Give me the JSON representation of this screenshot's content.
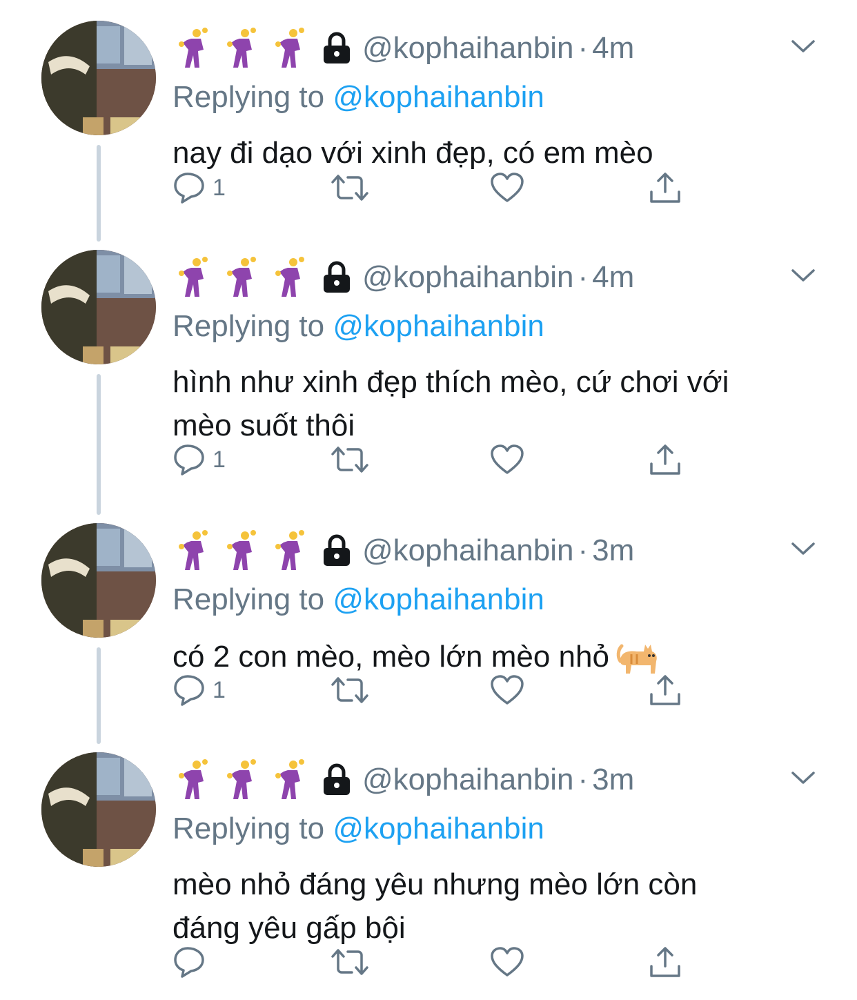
{
  "tweets": [
    {
      "handle": "@kophaihanbin",
      "time": "4m",
      "reply_prefix": "Replying to",
      "reply_to": "@kophaihanbin",
      "text": "nay đi dạo với xinh đẹp, có em mèo",
      "reply_count": "1"
    },
    {
      "handle": "@kophaihanbin",
      "time": "4m",
      "reply_prefix": "Replying to",
      "reply_to": "@kophaihanbin",
      "text": "hình như xinh đẹp thích mèo, cứ chơi với mèo suốt thôi",
      "reply_count": "1"
    },
    {
      "handle": "@kophaihanbin",
      "time": "3m",
      "reply_prefix": "Replying to",
      "reply_to": "@kophaihanbin",
      "text": "có 2 con mèo, mèo lớn mèo nhỏ",
      "text_emoji": "cat-emoji",
      "reply_count": "1"
    },
    {
      "handle": "@kophaihanbin",
      "time": "3m",
      "reply_prefix": "Replying to",
      "reply_to": "@kophaihanbin",
      "text": "mèo nhỏ đáng yêu nhưng mèo lớn còn đáng yêu gấp bội",
      "reply_count": ""
    }
  ],
  "display_name_icons": [
    "dancing-man-emoji",
    "dancing-man-emoji",
    "dancing-man-emoji"
  ],
  "colors": {
    "secondary_text": "#657786",
    "link": "#1da1f2",
    "primary_text": "#14171a",
    "thread_line": "#c9d4de"
  }
}
